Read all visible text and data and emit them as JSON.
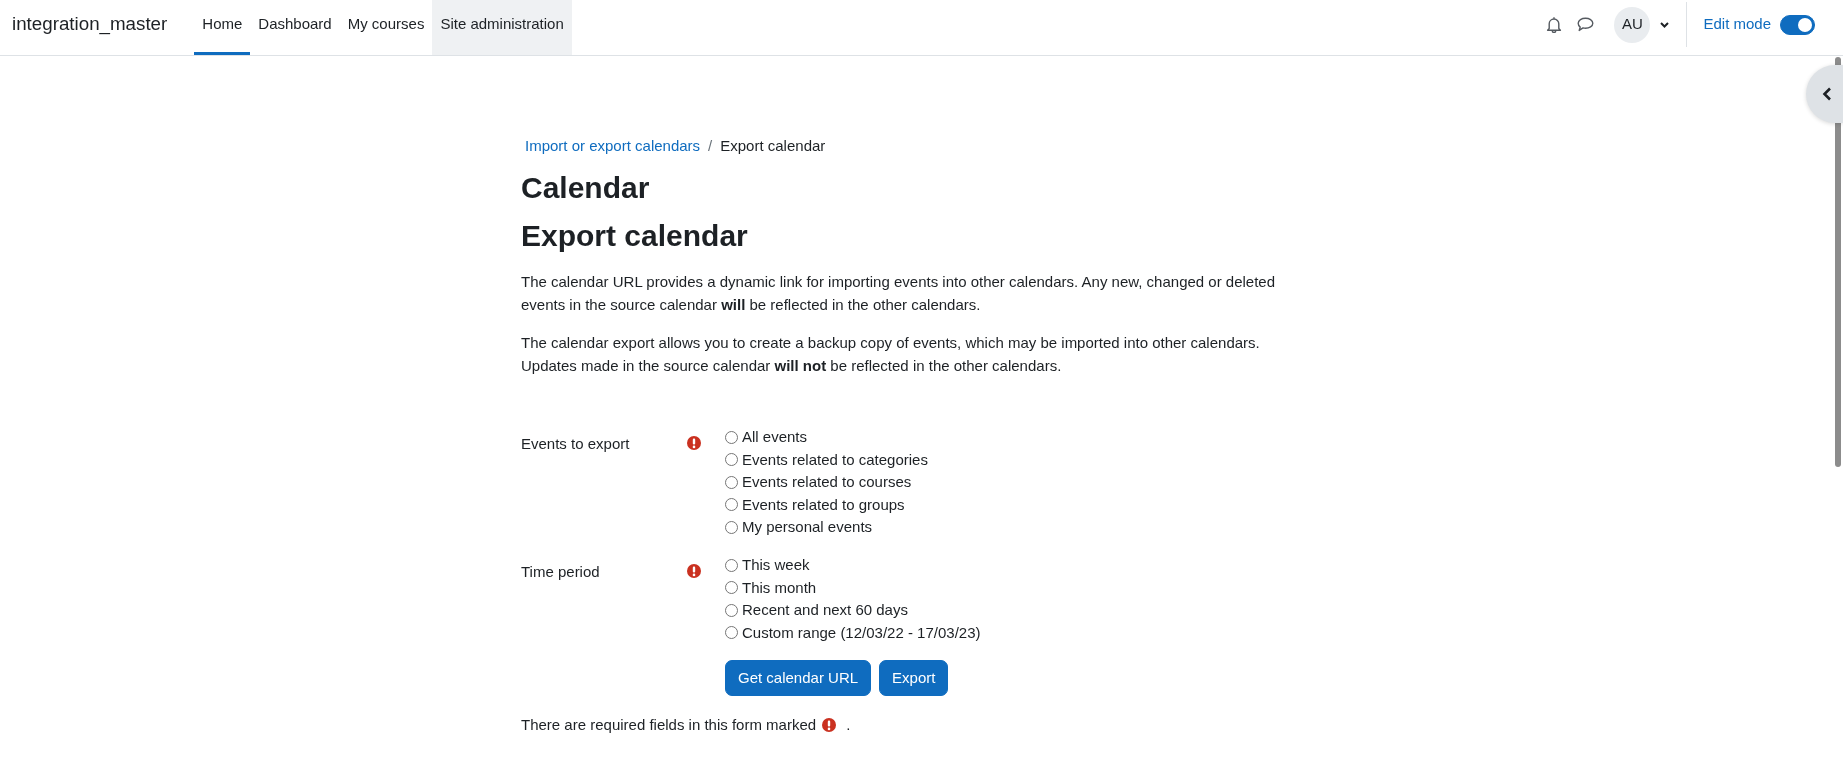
{
  "navbar": {
    "brand": "integration_master",
    "nav_items": [
      {
        "label": "Home",
        "selected": true,
        "hovered": false
      },
      {
        "label": "Dashboard",
        "selected": false,
        "hovered": false
      },
      {
        "label": "My courses",
        "selected": false,
        "hovered": false
      },
      {
        "label": "Site administration",
        "selected": false,
        "hovered": true
      }
    ],
    "user_initials": "AU",
    "edit_mode": {
      "label": "Edit mode",
      "on": true
    }
  },
  "breadcrumb": {
    "items": [
      {
        "label": "Import or export calendars",
        "kind": "link"
      },
      {
        "label": "Export calendar",
        "kind": "current"
      }
    ],
    "separator": "/"
  },
  "page_title": "Calendar",
  "heading": "Export calendar",
  "paragraphs": [
    "The calendar URL provides a dynamic link for importing events into other calendars. Any new, changed or deleted events in the source calendar **will** be reflected in the other calendars.",
    "The calendar export allows you to create a backup copy of events, which may be imported into other calendars. Updates made in the source calendar **will not** be reflected in the other calendars."
  ],
  "form": {
    "fields": [
      {
        "label": "Events to export",
        "required": true,
        "options": [
          {
            "label": "All events",
            "selected": false
          },
          {
            "label": "Events related to categories",
            "selected": false
          },
          {
            "label": "Events related to courses",
            "selected": false
          },
          {
            "label": "Events related to groups",
            "selected": false
          },
          {
            "label": "My personal events",
            "selected": false
          }
        ]
      },
      {
        "label": "Time period",
        "required": true,
        "options": [
          {
            "label": "This week",
            "selected": false
          },
          {
            "label": "This month",
            "selected": false
          },
          {
            "label": "Recent and next 60 days",
            "selected": false
          },
          {
            "label": "Custom range (12/03/22 - 17/03/23)",
            "selected": false
          }
        ]
      }
    ],
    "buttons": [
      {
        "label": "Get calendar URL"
      },
      {
        "label": "Export"
      }
    ],
    "required_note": {
      "text": "There are required fields in this form marked",
      "end": "."
    }
  }
}
